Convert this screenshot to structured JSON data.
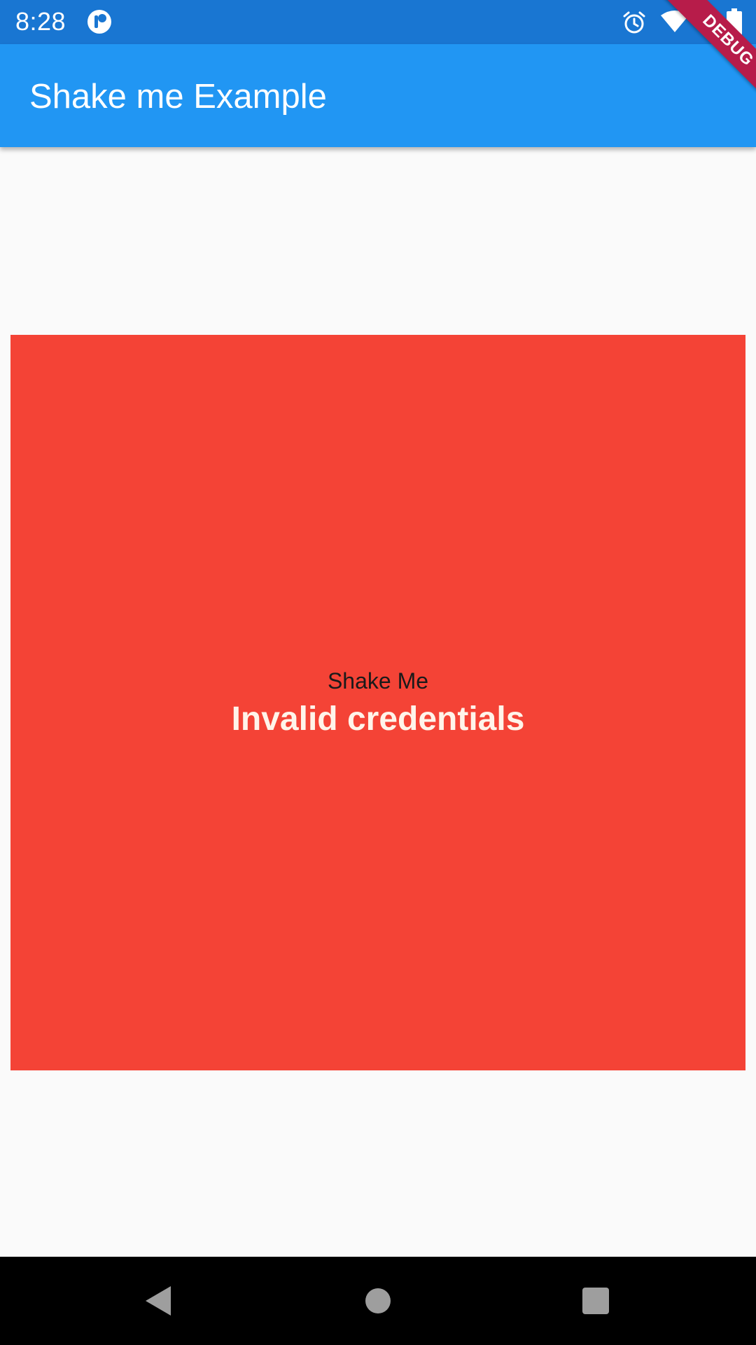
{
  "status_bar": {
    "time": "8:28",
    "icons": [
      "notification-icon",
      "alarm-icon",
      "wifi-icon",
      "battery-icon"
    ]
  },
  "app_bar": {
    "title": "Shake me Example",
    "debug_banner": "DEBUG"
  },
  "main": {
    "box_color": "#f44336",
    "label": "Shake Me",
    "message": "Invalid credentials"
  },
  "nav_bar": {
    "icons": [
      "back-icon",
      "home-icon",
      "recents-icon"
    ]
  },
  "colors": {
    "status_bar": "#1976d2",
    "app_bar": "#2196f3",
    "accent_red": "#f44336",
    "debug_banner": "#b71c4a"
  }
}
